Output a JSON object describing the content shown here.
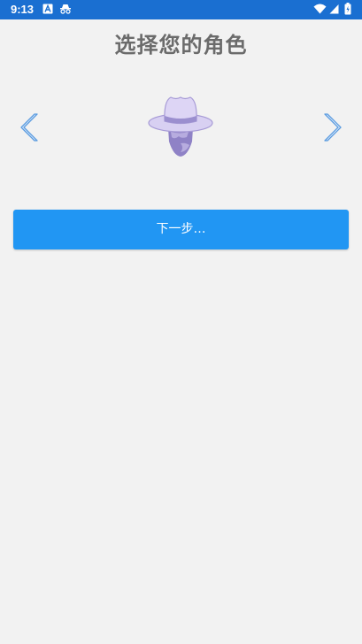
{
  "status_bar": {
    "time": "9:13",
    "left_icons": [
      "a-box-icon",
      "incognito-icon"
    ],
    "right_icons": [
      "wifi-icon",
      "signal-icon",
      "battery-icon"
    ]
  },
  "page": {
    "title": "选择您的角色"
  },
  "role_selector": {
    "prev_icon": "chevron-left-icon",
    "next_icon": "chevron-right-icon",
    "avatar_icon": "incognito-avatar-icon"
  },
  "actions": {
    "next_label": "下一步…"
  },
  "colors": {
    "status_bar": "#1a6fd1",
    "background": "#f2f2f2",
    "primary_button": "#2196f3",
    "title_text": "#6b6b6b",
    "avatar_light": "#d8d0f2",
    "avatar_dark": "#9b8fcf"
  }
}
